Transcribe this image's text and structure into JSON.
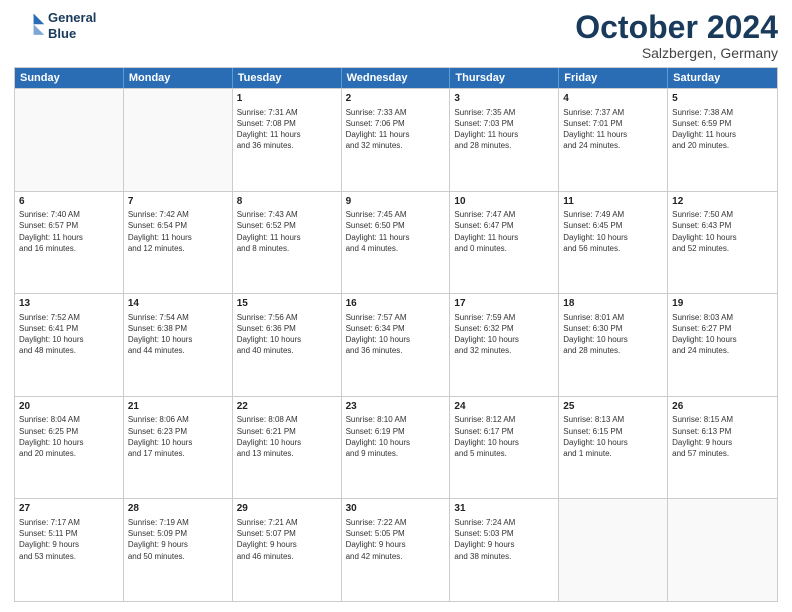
{
  "header": {
    "logo_line1": "General",
    "logo_line2": "Blue",
    "month": "October 2024",
    "location": "Salzbergen, Germany"
  },
  "days_of_week": [
    "Sunday",
    "Monday",
    "Tuesday",
    "Wednesday",
    "Thursday",
    "Friday",
    "Saturday"
  ],
  "weeks": [
    [
      {
        "day": "",
        "text": "",
        "empty": true
      },
      {
        "day": "",
        "text": "",
        "empty": true
      },
      {
        "day": "1",
        "text": "Sunrise: 7:31 AM\nSunset: 7:08 PM\nDaylight: 11 hours\nand 36 minutes."
      },
      {
        "day": "2",
        "text": "Sunrise: 7:33 AM\nSunset: 7:06 PM\nDaylight: 11 hours\nand 32 minutes."
      },
      {
        "day": "3",
        "text": "Sunrise: 7:35 AM\nSunset: 7:03 PM\nDaylight: 11 hours\nand 28 minutes."
      },
      {
        "day": "4",
        "text": "Sunrise: 7:37 AM\nSunset: 7:01 PM\nDaylight: 11 hours\nand 24 minutes."
      },
      {
        "day": "5",
        "text": "Sunrise: 7:38 AM\nSunset: 6:59 PM\nDaylight: 11 hours\nand 20 minutes."
      }
    ],
    [
      {
        "day": "6",
        "text": "Sunrise: 7:40 AM\nSunset: 6:57 PM\nDaylight: 11 hours\nand 16 minutes."
      },
      {
        "day": "7",
        "text": "Sunrise: 7:42 AM\nSunset: 6:54 PM\nDaylight: 11 hours\nand 12 minutes."
      },
      {
        "day": "8",
        "text": "Sunrise: 7:43 AM\nSunset: 6:52 PM\nDaylight: 11 hours\nand 8 minutes."
      },
      {
        "day": "9",
        "text": "Sunrise: 7:45 AM\nSunset: 6:50 PM\nDaylight: 11 hours\nand 4 minutes."
      },
      {
        "day": "10",
        "text": "Sunrise: 7:47 AM\nSunset: 6:47 PM\nDaylight: 11 hours\nand 0 minutes."
      },
      {
        "day": "11",
        "text": "Sunrise: 7:49 AM\nSunset: 6:45 PM\nDaylight: 10 hours\nand 56 minutes."
      },
      {
        "day": "12",
        "text": "Sunrise: 7:50 AM\nSunset: 6:43 PM\nDaylight: 10 hours\nand 52 minutes."
      }
    ],
    [
      {
        "day": "13",
        "text": "Sunrise: 7:52 AM\nSunset: 6:41 PM\nDaylight: 10 hours\nand 48 minutes."
      },
      {
        "day": "14",
        "text": "Sunrise: 7:54 AM\nSunset: 6:38 PM\nDaylight: 10 hours\nand 44 minutes."
      },
      {
        "day": "15",
        "text": "Sunrise: 7:56 AM\nSunset: 6:36 PM\nDaylight: 10 hours\nand 40 minutes."
      },
      {
        "day": "16",
        "text": "Sunrise: 7:57 AM\nSunset: 6:34 PM\nDaylight: 10 hours\nand 36 minutes."
      },
      {
        "day": "17",
        "text": "Sunrise: 7:59 AM\nSunset: 6:32 PM\nDaylight: 10 hours\nand 32 minutes."
      },
      {
        "day": "18",
        "text": "Sunrise: 8:01 AM\nSunset: 6:30 PM\nDaylight: 10 hours\nand 28 minutes."
      },
      {
        "day": "19",
        "text": "Sunrise: 8:03 AM\nSunset: 6:27 PM\nDaylight: 10 hours\nand 24 minutes."
      }
    ],
    [
      {
        "day": "20",
        "text": "Sunrise: 8:04 AM\nSunset: 6:25 PM\nDaylight: 10 hours\nand 20 minutes."
      },
      {
        "day": "21",
        "text": "Sunrise: 8:06 AM\nSunset: 6:23 PM\nDaylight: 10 hours\nand 17 minutes."
      },
      {
        "day": "22",
        "text": "Sunrise: 8:08 AM\nSunset: 6:21 PM\nDaylight: 10 hours\nand 13 minutes."
      },
      {
        "day": "23",
        "text": "Sunrise: 8:10 AM\nSunset: 6:19 PM\nDaylight: 10 hours\nand 9 minutes."
      },
      {
        "day": "24",
        "text": "Sunrise: 8:12 AM\nSunset: 6:17 PM\nDaylight: 10 hours\nand 5 minutes."
      },
      {
        "day": "25",
        "text": "Sunrise: 8:13 AM\nSunset: 6:15 PM\nDaylight: 10 hours\nand 1 minute."
      },
      {
        "day": "26",
        "text": "Sunrise: 8:15 AM\nSunset: 6:13 PM\nDaylight: 9 hours\nand 57 minutes."
      }
    ],
    [
      {
        "day": "27",
        "text": "Sunrise: 7:17 AM\nSunset: 5:11 PM\nDaylight: 9 hours\nand 53 minutes."
      },
      {
        "day": "28",
        "text": "Sunrise: 7:19 AM\nSunset: 5:09 PM\nDaylight: 9 hours\nand 50 minutes."
      },
      {
        "day": "29",
        "text": "Sunrise: 7:21 AM\nSunset: 5:07 PM\nDaylight: 9 hours\nand 46 minutes."
      },
      {
        "day": "30",
        "text": "Sunrise: 7:22 AM\nSunset: 5:05 PM\nDaylight: 9 hours\nand 42 minutes."
      },
      {
        "day": "31",
        "text": "Sunrise: 7:24 AM\nSunset: 5:03 PM\nDaylight: 9 hours\nand 38 minutes."
      },
      {
        "day": "",
        "text": "",
        "empty": true
      },
      {
        "day": "",
        "text": "",
        "empty": true
      }
    ]
  ]
}
